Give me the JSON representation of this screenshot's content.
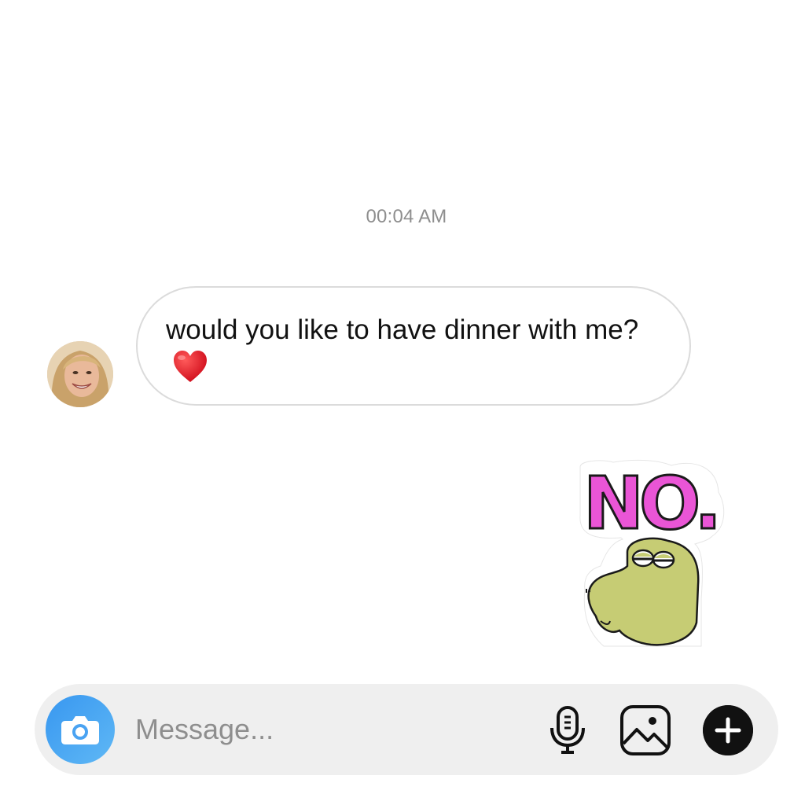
{
  "thread": {
    "timestamp": "00:04 AM",
    "incoming_message": {
      "text": "would you like to have dinner with me?",
      "emoji_icon": "red-heart-icon"
    },
    "outgoing_sticker": {
      "text": "NO.",
      "icon": "sleepy-dinosaur-sticker",
      "text_color": "#ea55d6",
      "creature_color": "#c6cc74"
    }
  },
  "composer": {
    "placeholder": "Message...",
    "value": "",
    "camera_icon": "camera-icon",
    "camera_color": "#3897f0",
    "mic_icon": "microphone-icon",
    "gallery_icon": "gallery-icon",
    "plus_icon": "plus-icon"
  }
}
